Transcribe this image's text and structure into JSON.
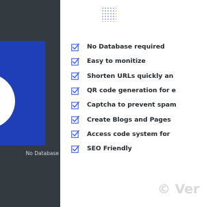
{
  "left_panel": {
    "caption": "No Database"
  },
  "features": [
    {
      "label": "No Database required"
    },
    {
      "label": "Easy to monitize"
    },
    {
      "label": "Shorten URLs quickly an"
    },
    {
      "label": "QR code generation for e"
    },
    {
      "label": "Captcha to prevent spam"
    },
    {
      "label": "Create Blogs and Pages"
    },
    {
      "label": "Access code system for"
    },
    {
      "label": "SEO Friendly"
    }
  ],
  "check_icon": "checkbox-check-icon",
  "watermark": "© Ver",
  "colors": {
    "panel_background": "#333b40",
    "card_blue": "#1f3fb8",
    "check_blue": "#3b5fe0",
    "text_dark": "#252a2f",
    "watermark_gray": "#d9d9d9"
  }
}
